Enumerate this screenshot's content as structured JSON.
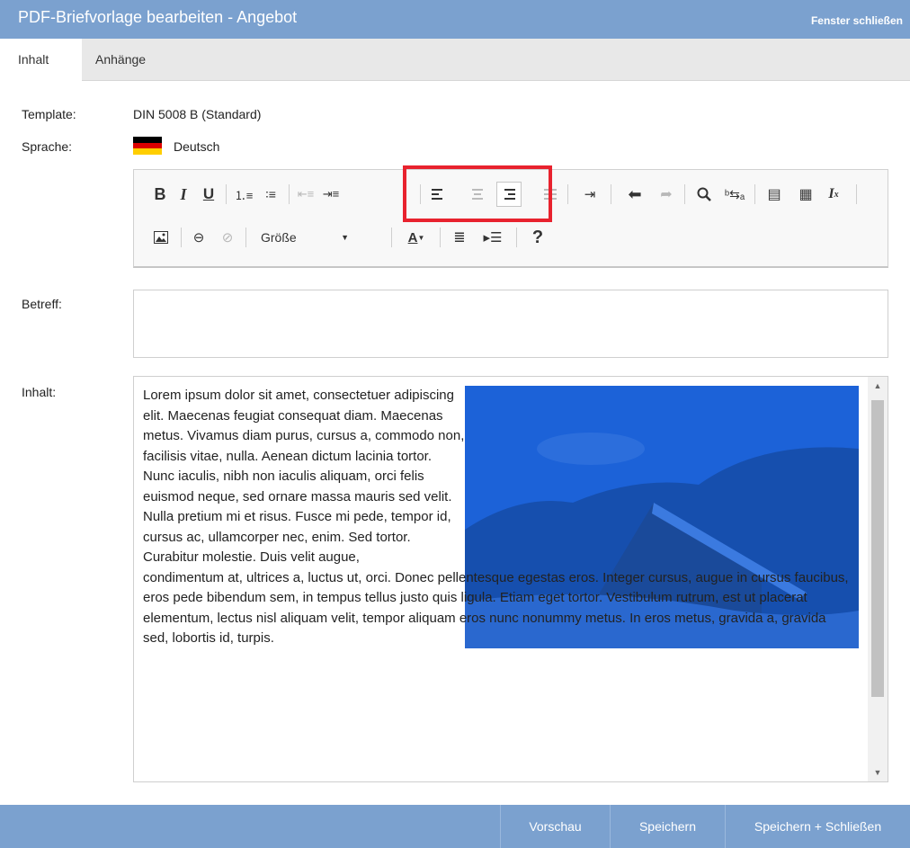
{
  "window": {
    "title": "PDF-Briefvorlage bearbeiten - Angebot",
    "close_label": "Fenster schließen"
  },
  "tabs": [
    {
      "label": "Inhalt",
      "active": true
    },
    {
      "label": "Anhänge",
      "active": false
    }
  ],
  "form": {
    "template_label": "Template:",
    "template_value": "DIN 5008 B (Standard)",
    "language_label": "Sprache:",
    "language_value": "Deutsch",
    "subject_label": "Betreff:",
    "subject_value": "",
    "content_label": "Inhalt:"
  },
  "toolbar": {
    "bold": "B",
    "italic": "I",
    "underline": "U",
    "font_size_label": "Größe",
    "help": "?"
  },
  "editor": {
    "col_text": "Lorem ipsum dolor sit amet, consectetuer adipiscing elit. Maecenas feugiat consequat diam. Maecenas metus. Vivamus diam purus, cursus a, commodo non, facilisis vitae, nulla. Aenean dictum lacinia tortor. Nunc iaculis, nibh non iaculis aliquam, orci felis euismod neque, sed ornare massa mauris sed velit. Nulla pretium mi et risus. Fusce mi pede, tempor id, cursus ac, ullamcorper nec, enim. Sed tortor. Curabitur molestie. Duis velit augue,",
    "full_text": "condimentum at, ultrices a, luctus ut, orci. Donec pellentesque egestas eros. Integer cursus, augue in cursus faucibus, eros pede bibendum sem, in tempus tellus justo quis ligula. Etiam eget tortor. Vestibulum rutrum, est ut placerat elementum, lectus nisl aliquam velit, tempor aliquam eros nunc nonummy metus. In eros metus, gravida a, gravida sed, lobortis id, turpis."
  },
  "footer": {
    "preview": "Vorschau",
    "save": "Speichern",
    "save_close": "Speichern + Schließen"
  },
  "colors": {
    "header_bg": "#7ba1cf",
    "highlight": "#e8222e",
    "image_tint": "#1e5ec8"
  }
}
